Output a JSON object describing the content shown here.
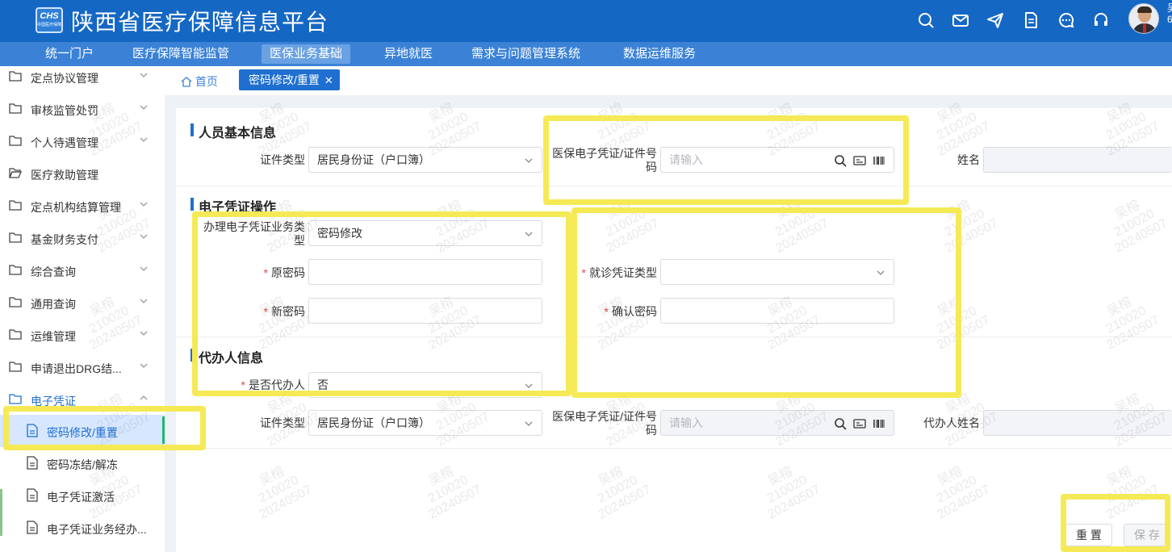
{
  "header": {
    "logo_text": "CHS",
    "logo_sub": "中国医疗保障",
    "title": "陕西省医疗保障信息平台",
    "icons": [
      "search-icon",
      "mail-icon",
      "send-icon",
      "document-icon",
      "chat-icon",
      "headset-icon"
    ],
    "user_name_partial": "吴",
    "user_id_partial": "6"
  },
  "nav": {
    "items": [
      {
        "label": "统一门户"
      },
      {
        "label": "医疗保障智能监管"
      },
      {
        "label": "医保业务基础"
      },
      {
        "label": "异地就医"
      },
      {
        "label": "需求与问题管理系统"
      },
      {
        "label": "数据运维服务"
      }
    ],
    "active_index": 2
  },
  "sidebar": {
    "items": [
      {
        "label": "定点协议管理"
      },
      {
        "label": "审核监管处罚"
      },
      {
        "label": "个人待遇管理"
      },
      {
        "label": "医疗救助管理"
      },
      {
        "label": "定点机构结算管理"
      },
      {
        "label": "基金财务支付"
      },
      {
        "label": "综合查询"
      },
      {
        "label": "通用查询"
      },
      {
        "label": "运维管理"
      },
      {
        "label": "申请退出DRG结..."
      },
      {
        "label": "电子凭证"
      }
    ],
    "sub_items": [
      {
        "label": "密码修改/重置"
      },
      {
        "label": "密码冻结/解冻"
      },
      {
        "label": "电子凭证激活"
      },
      {
        "label": "电子凭证业务经办..."
      }
    ]
  },
  "tabs": {
    "home": "首页",
    "active": "密码修改/重置",
    "close": "✕"
  },
  "form": {
    "section_basic": "人员基本信息",
    "cert_type_label": "证件类型",
    "cert_type_value": "居民身份证（户口簿）",
    "ecert_label_1": "医保电子凭证/证件号",
    "ecert_label_2": "码",
    "ecert_placeholder": "请输入",
    "name_label": "姓名",
    "section_op": "电子凭证操作",
    "biz_type_label_1": "办理电子凭证业务类",
    "biz_type_label_2": "型",
    "biz_type_value": "密码修改",
    "old_pwd_label": "原密码",
    "visit_cert_label": "就诊凭证类型",
    "new_pwd_label": "新密码",
    "confirm_pwd_label": "确认密码",
    "required_mark": "*",
    "section_agent": "代办人信息",
    "is_agent_label": "是否代办人",
    "is_agent_value": "否",
    "agent_cert_type_label": "证件类型",
    "agent_cert_type_value": "居民身份证（户口簿）",
    "agent_ecert_label_1": "医保电子凭证/证件号",
    "agent_ecert_label_2": "码",
    "agent_ecert_placeholder": "请输入",
    "agent_name_label": "代办人姓名"
  },
  "buttons": {
    "reset": "重 置",
    "save": "保 存"
  },
  "watermark": {
    "name": "吴榕",
    "id": "210020",
    "date": "20240507"
  },
  "colors": {
    "header": "#1567c4",
    "nav": "#3b82d6",
    "accent": "#1f6fd0",
    "highlight": "#f5ea55",
    "required": "#e54545"
  }
}
